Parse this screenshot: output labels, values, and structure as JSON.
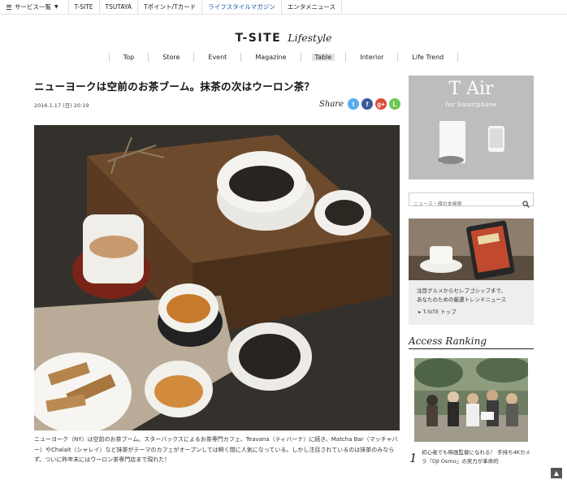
{
  "topbar": {
    "services_label": "サービス一覧",
    "links": [
      {
        "label": "T-SITE"
      },
      {
        "label": "TSUTAYA"
      },
      {
        "label": "Tポイント/Tカード"
      },
      {
        "label": "ライフスタイルマガジン",
        "active": true
      },
      {
        "label": "エンタメニュース"
      }
    ]
  },
  "logo": {
    "brand": "T-SITE",
    "sub": "Lifestyle"
  },
  "nav": {
    "items": [
      {
        "label": "Top"
      },
      {
        "label": "Store"
      },
      {
        "label": "Event"
      },
      {
        "label": "Magazine"
      },
      {
        "label": "Table",
        "active": true
      },
      {
        "label": "Interior"
      },
      {
        "label": "Life Trend"
      }
    ]
  },
  "article": {
    "title": "ニューヨークは空前のお茶ブーム。抹茶の次はウーロン茶？",
    "date": "2016.1.17 (日) 20:19",
    "share_label": "Share",
    "share_icons": [
      {
        "name": "twitter",
        "glyph": "t",
        "color": "#55acee"
      },
      {
        "name": "facebook",
        "glyph": "f",
        "color": "#3b5998"
      },
      {
        "name": "googleplus",
        "glyph": "g+",
        "color": "#dd4b39"
      },
      {
        "name": "line",
        "glyph": "L",
        "color": "#6cc655"
      }
    ],
    "body": "ニューヨーク（NY）は空前のお茶ブーム。スターバックスによるお茶専門カフェ、Teavana（ティバーナ）に続き、Matcha Bar（マッチャバー）やChalait（シャレイ）など抹茶がテーマのカフェがオープンしては瞬く間に人気になっている。しかし注目されているのは抹茶のみならず。ついに昨年末にはウーロン茶専門店まで現れた！"
  },
  "sidebar": {
    "ad": {
      "title": "T Air",
      "subtitle": "for Smartphone"
    },
    "search": {
      "placeholder": "ニュース・雑の本検索"
    },
    "promo": {
      "text_line1": "注目グルメからセレブゴシップまで、",
      "text_line2": "あなたのための厳選トレンドニュース",
      "link": "T-SITE トップ"
    },
    "ranking": {
      "heading": "Access Ranking",
      "items": [
        {
          "rank": "1",
          "title": "初心者でも映画監督になれる！ 手持ち4Kカメラ『DJI Osmo』の実力が革命的"
        }
      ]
    }
  },
  "colors": {
    "accent": "#1a56a8",
    "ad_bg": "#bdbdbd",
    "promo_bg": "#eeeeee"
  }
}
